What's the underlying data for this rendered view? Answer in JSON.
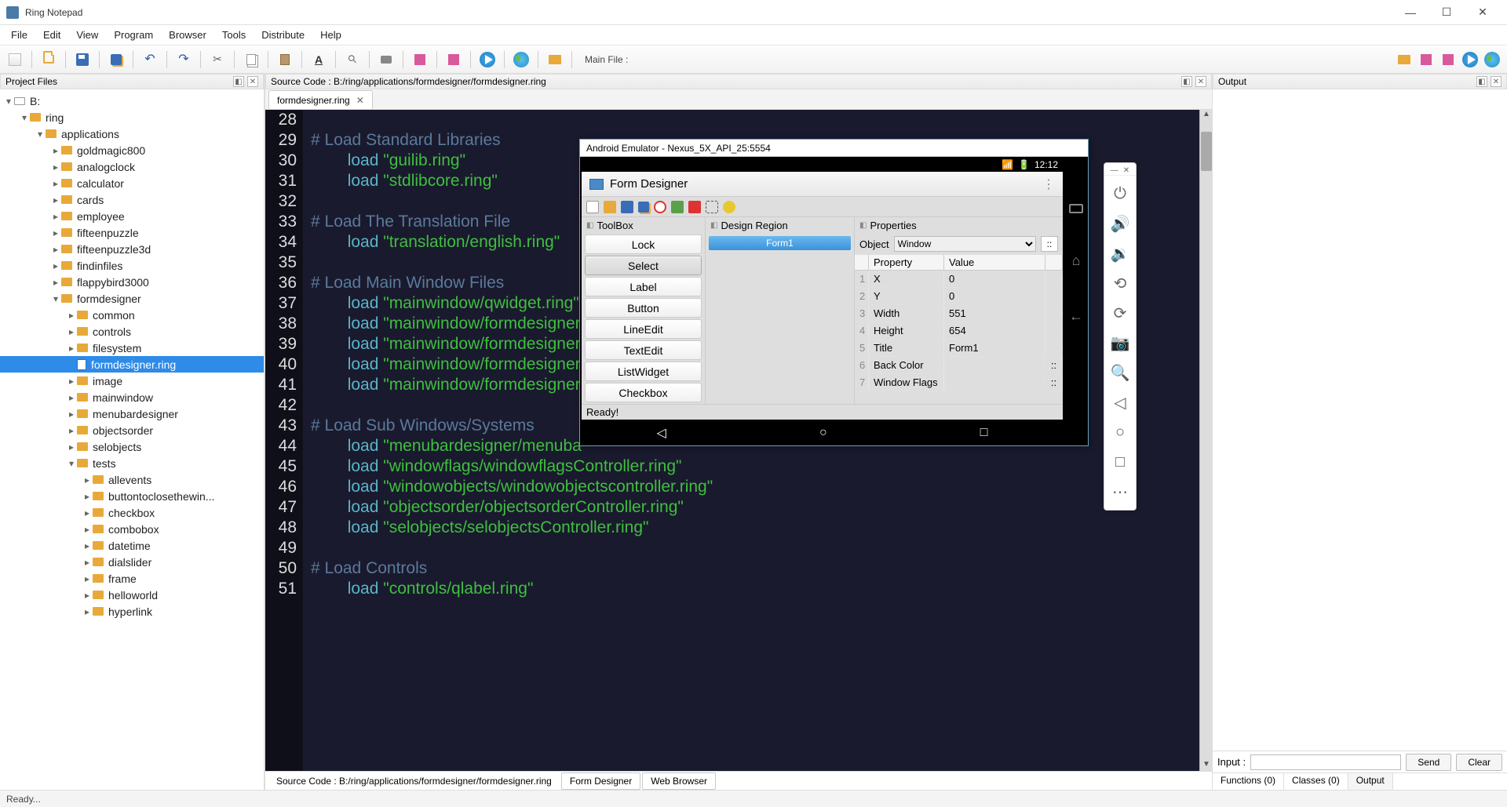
{
  "app": {
    "title": "Ring Notepad"
  },
  "menu": [
    "File",
    "Edit",
    "View",
    "Program",
    "Browser",
    "Tools",
    "Distribute",
    "Help"
  ],
  "toolbar": {
    "mainFileLabel": "Main File :"
  },
  "projectPanel": {
    "title": "Project Files"
  },
  "tree": [
    {
      "d": 0,
      "exp": "▾",
      "icon": "drive",
      "label": "B:"
    },
    {
      "d": 1,
      "exp": "▾",
      "icon": "folder",
      "label": "ring"
    },
    {
      "d": 2,
      "exp": "▾",
      "icon": "folder",
      "label": "applications"
    },
    {
      "d": 3,
      "exp": "▸",
      "icon": "folder",
      "label": "goldmagic800"
    },
    {
      "d": 3,
      "exp": "▸",
      "icon": "folder",
      "label": "analogclock"
    },
    {
      "d": 3,
      "exp": "▸",
      "icon": "folder",
      "label": "calculator"
    },
    {
      "d": 3,
      "exp": "▸",
      "icon": "folder",
      "label": "cards"
    },
    {
      "d": 3,
      "exp": "▸",
      "icon": "folder",
      "label": "employee"
    },
    {
      "d": 3,
      "exp": "▸",
      "icon": "folder",
      "label": "fifteenpuzzle"
    },
    {
      "d": 3,
      "exp": "▸",
      "icon": "folder",
      "label": "fifteenpuzzle3d"
    },
    {
      "d": 3,
      "exp": "▸",
      "icon": "folder",
      "label": "findinfiles"
    },
    {
      "d": 3,
      "exp": "▸",
      "icon": "folder",
      "label": "flappybird3000"
    },
    {
      "d": 3,
      "exp": "▾",
      "icon": "folder",
      "label": "formdesigner"
    },
    {
      "d": 4,
      "exp": "▸",
      "icon": "folder",
      "label": "common"
    },
    {
      "d": 4,
      "exp": "▸",
      "icon": "folder",
      "label": "controls"
    },
    {
      "d": 4,
      "exp": "▸",
      "icon": "folder",
      "label": "filesystem"
    },
    {
      "d": 4,
      "exp": "",
      "icon": "file",
      "label": "formdesigner.ring",
      "sel": true
    },
    {
      "d": 4,
      "exp": "▸",
      "icon": "folder",
      "label": "image"
    },
    {
      "d": 4,
      "exp": "▸",
      "icon": "folder",
      "label": "mainwindow"
    },
    {
      "d": 4,
      "exp": "▸",
      "icon": "folder",
      "label": "menubardesigner"
    },
    {
      "d": 4,
      "exp": "▸",
      "icon": "folder",
      "label": "objectsorder"
    },
    {
      "d": 4,
      "exp": "▸",
      "icon": "folder",
      "label": "selobjects"
    },
    {
      "d": 4,
      "exp": "▾",
      "icon": "folder",
      "label": "tests"
    },
    {
      "d": 5,
      "exp": "▸",
      "icon": "folder",
      "label": "allevents"
    },
    {
      "d": 5,
      "exp": "▸",
      "icon": "folder",
      "label": "buttontoclosethewin..."
    },
    {
      "d": 5,
      "exp": "▸",
      "icon": "folder",
      "label": "checkbox"
    },
    {
      "d": 5,
      "exp": "▸",
      "icon": "folder",
      "label": "combobox"
    },
    {
      "d": 5,
      "exp": "▸",
      "icon": "folder",
      "label": "datetime"
    },
    {
      "d": 5,
      "exp": "▸",
      "icon": "folder",
      "label": "dialslider"
    },
    {
      "d": 5,
      "exp": "▸",
      "icon": "folder",
      "label": "frame"
    },
    {
      "d": 5,
      "exp": "▸",
      "icon": "folder",
      "label": "helloworld"
    },
    {
      "d": 5,
      "exp": "▸",
      "icon": "folder",
      "label": "hyperlink"
    }
  ],
  "editor": {
    "panelTitle": "Source Code : B:/ring/applications/formdesigner/formdesigner.ring",
    "tab": "formdesigner.ring",
    "lines": [
      {
        "n": 28,
        "t": ""
      },
      {
        "n": 29,
        "t": "# Load Standard Libraries",
        "cls": "c-comment"
      },
      {
        "n": 30,
        "html": "        <span class='c-load'>load</span> <span class='c-str'>\"guilib.ring\"</span>"
      },
      {
        "n": 31,
        "html": "        <span class='c-load'>load</span> <span class='c-str'>\"stdlibcore.ring\"</span>"
      },
      {
        "n": 32,
        "t": ""
      },
      {
        "n": 33,
        "t": "# Load The Translation File",
        "cls": "c-comment"
      },
      {
        "n": 34,
        "html": "        <span class='c-load'>load</span> <span class='c-str'>\"translation/english.ring\"</span>"
      },
      {
        "n": 35,
        "t": ""
      },
      {
        "n": 36,
        "t": "# Load Main Window Files",
        "cls": "c-comment"
      },
      {
        "n": 37,
        "html": "        <span class='c-load'>load</span> <span class='c-str'>\"mainwindow/qwidget.ring\"</span>"
      },
      {
        "n": 38,
        "html": "        <span class='c-load'>load</span> <span class='c-str'>\"mainwindow/formdesigner</span>"
      },
      {
        "n": 39,
        "html": "        <span class='c-load'>load</span> <span class='c-str'>\"mainwindow/formdesigner</span>"
      },
      {
        "n": 40,
        "html": "        <span class='c-load'>load</span> <span class='c-str'>\"mainwindow/formdesigner</span>"
      },
      {
        "n": 41,
        "html": "        <span class='c-load'>load</span> <span class='c-str'>\"mainwindow/formdesigner</span>"
      },
      {
        "n": 42,
        "t": ""
      },
      {
        "n": 43,
        "t": "# Load Sub Windows/Systems",
        "cls": "c-comment"
      },
      {
        "n": 44,
        "html": "        <span class='c-load'>load</span> <span class='c-str'>\"menubardesigner/menuba</span>"
      },
      {
        "n": 45,
        "html": "        <span class='c-load'>load</span> <span class='c-str'>\"windowflags/windowflagsController.ring\"</span>"
      },
      {
        "n": 46,
        "html": "        <span class='c-load'>load</span> <span class='c-str'>\"windowobjects/windowobjectscontroller.ring\"</span>"
      },
      {
        "n": 47,
        "html": "        <span class='c-load'>load</span> <span class='c-str'>\"objectsorder/objectsorderController.ring\"</span>"
      },
      {
        "n": 48,
        "html": "        <span class='c-load'>load</span> <span class='c-str'>\"selobjects/selobjectsController.ring\"</span>"
      },
      {
        "n": 49,
        "t": ""
      },
      {
        "n": 50,
        "t": "# Load Controls",
        "cls": "c-comment"
      },
      {
        "n": 51,
        "html": "        <span class='c-load'>load</span> <span class='c-str'>\"controls/qlabel.ring\"</span>"
      }
    ],
    "bottomTabs": {
      "label": "Source Code : B:/ring/applications/formdesigner/formdesigner.ring",
      "tabs": [
        "Form Designer",
        "Web Browser"
      ]
    }
  },
  "output": {
    "title": "Output",
    "inputLabel": "Input :",
    "send": "Send",
    "clear": "Clear",
    "tabs": [
      "Functions (0)",
      "Classes (0)",
      "Output"
    ]
  },
  "status": "Ready...",
  "emulator": {
    "windowTitle": "Android Emulator - Nexus_5X_API_25:5554",
    "clock": "12:12",
    "appTitle": "Form Designer",
    "cols": {
      "toolbox": "ToolBox",
      "design": "Design Region",
      "props": "Properties"
    },
    "tools": [
      "Lock",
      "Select",
      "Label",
      "Button",
      "LineEdit",
      "TextEdit",
      "ListWidget",
      "Checkbox"
    ],
    "selectedTool": "Select",
    "form": "Form1",
    "objectLabel": "Object",
    "objectValue": "Window",
    "propHead": {
      "p": "Property",
      "v": "Value"
    },
    "properties": [
      {
        "i": "1",
        "p": "X",
        "v": "0"
      },
      {
        "i": "2",
        "p": "Y",
        "v": "0"
      },
      {
        "i": "3",
        "p": "Width",
        "v": "551"
      },
      {
        "i": "4",
        "p": "Height",
        "v": "654"
      },
      {
        "i": "5",
        "p": "Title",
        "v": "Form1"
      },
      {
        "i": "6",
        "p": "Back Color",
        "v": "",
        "btn": true
      },
      {
        "i": "7",
        "p": "Window Flags",
        "v": "",
        "btn": true
      }
    ],
    "statusText": "Ready!"
  }
}
